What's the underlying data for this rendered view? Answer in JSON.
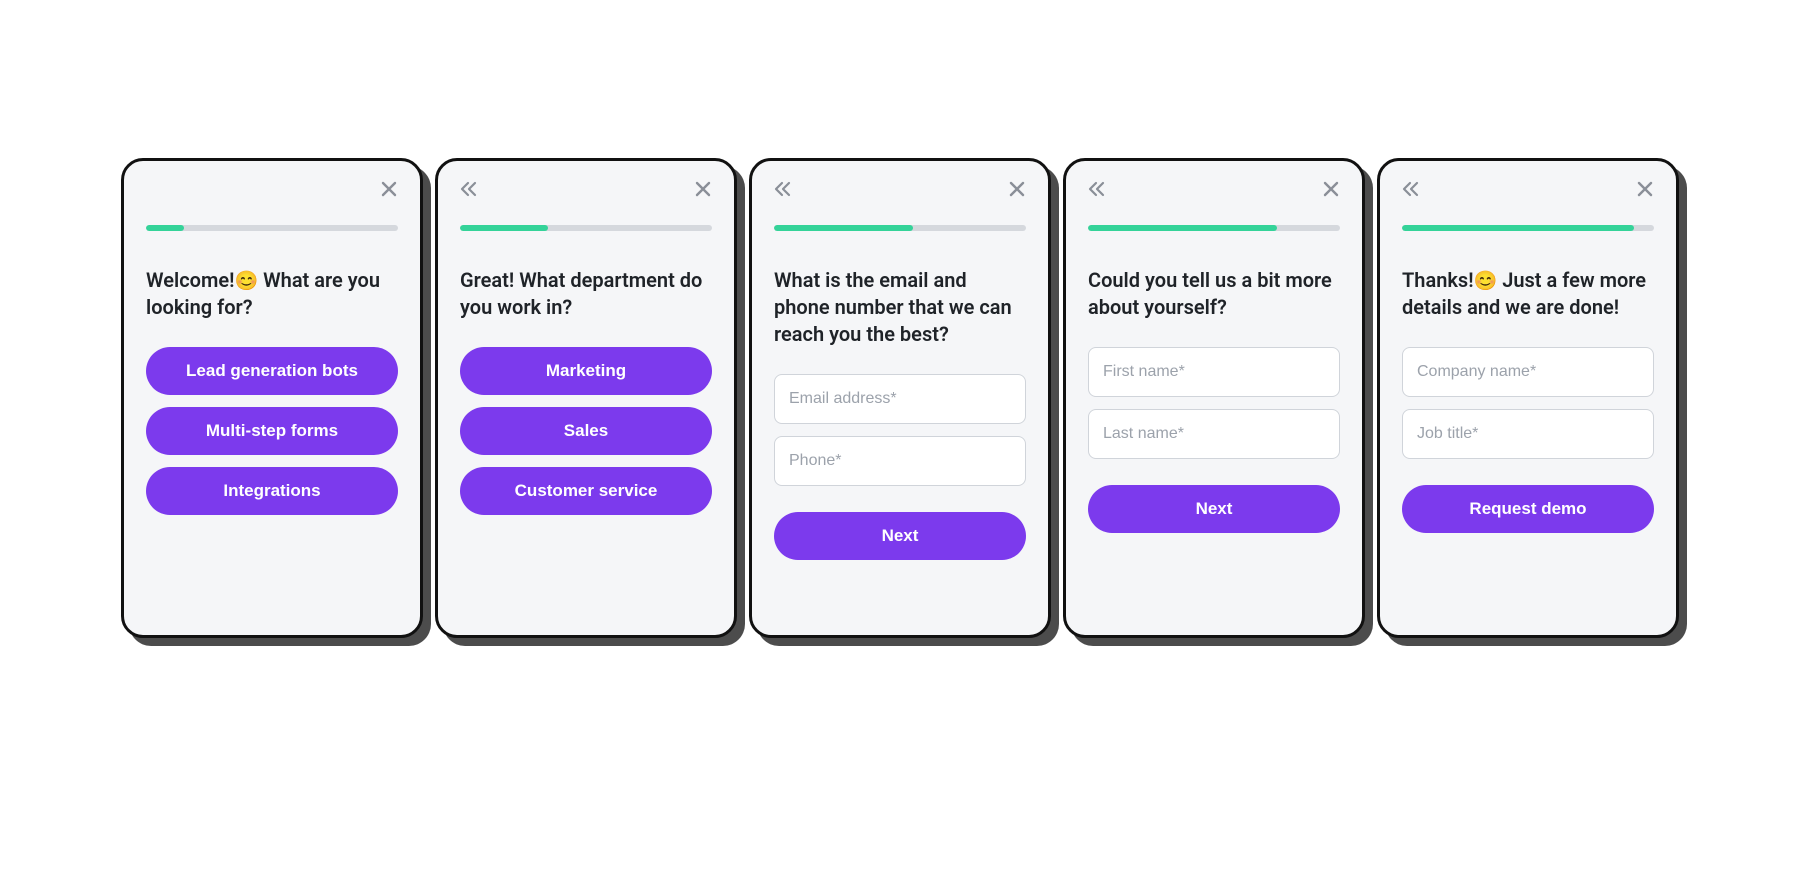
{
  "colors": {
    "accent": "#7c3aed",
    "progress": "#34d399"
  },
  "cards": [
    {
      "has_back": false,
      "progress_pct": 15,
      "prompt_pre": "Welcome!",
      "prompt_emoji": "😊",
      "prompt_post": " What are you looking for?",
      "options": [
        "Lead generation bots",
        "Multi-step forms",
        "Integrations"
      ]
    },
    {
      "has_back": true,
      "progress_pct": 35,
      "prompt_pre": "Great! What department do you work in?",
      "prompt_emoji": "",
      "prompt_post": "",
      "options": [
        "Marketing",
        "Sales",
        "Customer service"
      ]
    },
    {
      "has_back": true,
      "progress_pct": 55,
      "prompt_pre": "What is the email and phone number that we can reach you the best?",
      "prompt_emoji": "",
      "prompt_post": "",
      "inputs": [
        "Email address*",
        "Phone*"
      ],
      "cta": "Next"
    },
    {
      "has_back": true,
      "progress_pct": 75,
      "prompt_pre": "Could you tell us a bit more about yourself?",
      "prompt_emoji": "",
      "prompt_post": "",
      "inputs": [
        "First name*",
        "Last name*"
      ],
      "cta": "Next"
    },
    {
      "has_back": true,
      "progress_pct": 92,
      "prompt_pre": "Thanks!",
      "prompt_emoji": "😊",
      "prompt_post": " Just a few more details and we are done!",
      "inputs": [
        "Company name*",
        "Job title*"
      ],
      "cta": "Request demo"
    }
  ]
}
